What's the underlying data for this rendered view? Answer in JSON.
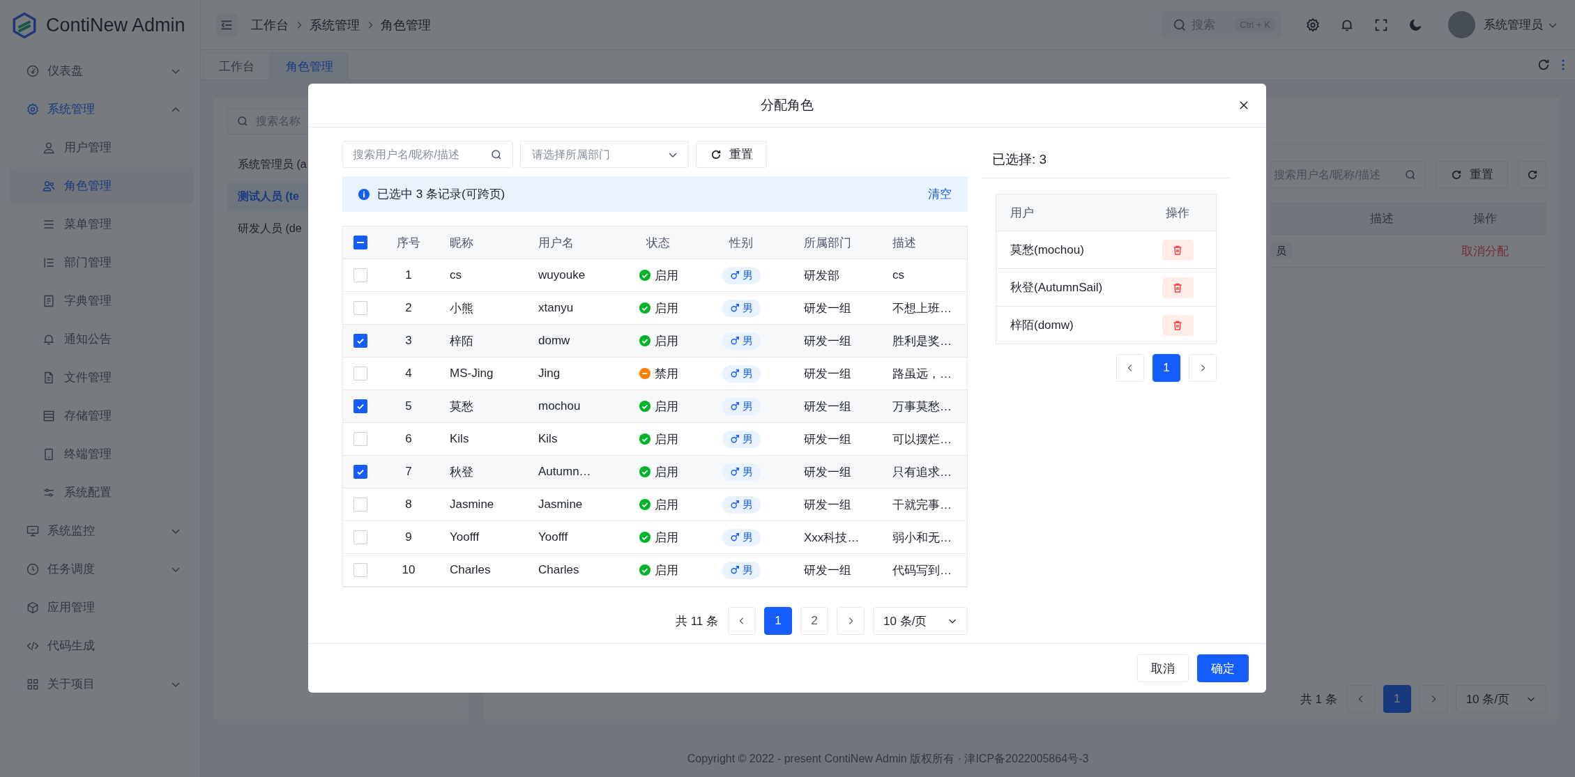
{
  "app": {
    "name": "ContiNew Admin"
  },
  "sidebar": {
    "items": [
      {
        "label": "仪表盘",
        "expanded": false,
        "selected": false
      },
      {
        "label": "系统管理",
        "expanded": true,
        "selected": true,
        "children": [
          {
            "label": "用户管理",
            "selected": false
          },
          {
            "label": "角色管理",
            "selected": true
          },
          {
            "label": "菜单管理",
            "selected": false
          },
          {
            "label": "部门管理",
            "selected": false
          },
          {
            "label": "字典管理",
            "selected": false
          },
          {
            "label": "通知公告",
            "selected": false
          },
          {
            "label": "文件管理",
            "selected": false
          },
          {
            "label": "存储管理",
            "selected": false
          },
          {
            "label": "终端管理",
            "selected": false
          },
          {
            "label": "系统配置",
            "selected": false
          }
        ]
      },
      {
        "label": "系统监控",
        "expanded": false,
        "selected": false
      },
      {
        "label": "任务调度",
        "expanded": false,
        "selected": false
      },
      {
        "label": "应用管理",
        "selected": false
      },
      {
        "label": "代码生成",
        "selected": false
      },
      {
        "label": "关于项目",
        "expanded": false,
        "selected": false
      }
    ]
  },
  "header": {
    "breadcrumb": [
      "工作台",
      "系统管理",
      "角色管理"
    ],
    "search": {
      "placeholder": "搜索",
      "shortcut": "Ctrl + K"
    },
    "user": "系统管理员"
  },
  "tabs": [
    {
      "label": "工作台",
      "selected": false
    },
    {
      "label": "角色管理",
      "selected": true
    }
  ],
  "role_panel": {
    "search": {
      "placeholder": "搜索名称"
    },
    "roles": [
      {
        "label": "系统管理员 (a",
        "selected": false
      },
      {
        "label": "测试人员 (te",
        "selected": true
      },
      {
        "label": "研发人员 (de",
        "selected": false
      }
    ]
  },
  "user_panel": {
    "search": {
      "placeholder": "搜索用户名/昵称/描述"
    },
    "reset": "重置",
    "columns": [
      "描述",
      "操作"
    ],
    "rows": [
      {
        "tag": "员",
        "action": "取消分配"
      }
    ],
    "pagination": {
      "total": "共 1 条",
      "pages": [
        {
          "label": "1",
          "selected": true
        }
      ],
      "page_size": "10 条/页"
    }
  },
  "modal": {
    "title": "分配角色",
    "search": {
      "placeholder": "搜索用户名/昵称/描述"
    },
    "dept_select": {
      "placeholder": "请选择所属部门"
    },
    "reset": "重置",
    "alert": {
      "text": "已选中 3 条记录(可跨页)",
      "action": "清空"
    },
    "table": {
      "select_all_indeterminate": true,
      "columns": [
        "序号",
        "昵称",
        "用户名",
        "状态",
        "性别",
        "所属部门",
        "描述"
      ],
      "rows": [
        {
          "checked": false,
          "index": "1",
          "nickname": "cs",
          "username": "wuyouke",
          "status": {
            "kind": "enabled",
            "label": "启用"
          },
          "gender": "男",
          "dept": "研发部",
          "description": "cs"
        },
        {
          "checked": false,
          "index": "2",
          "nickname": "小熊",
          "username": "xtanyu",
          "status": {
            "kind": "enabled",
            "label": "启用"
          },
          "gender": "男",
          "dept": "研发一组",
          "description": "不想上班…"
        },
        {
          "checked": true,
          "index": "3",
          "nickname": "梓陌",
          "username": "domw",
          "status": {
            "kind": "enabled",
            "label": "启用"
          },
          "gender": "男",
          "dept": "研发一组",
          "description": "胜利是奖…"
        },
        {
          "checked": false,
          "index": "4",
          "nickname": "MS-Jing",
          "username": "Jing",
          "status": {
            "kind": "disabled",
            "label": "禁用"
          },
          "gender": "男",
          "dept": "研发一组",
          "description": "路虽远，…"
        },
        {
          "checked": true,
          "index": "5",
          "nickname": "莫愁",
          "username": "mochou",
          "status": {
            "kind": "enabled",
            "label": "启用"
          },
          "gender": "男",
          "dept": "研发一组",
          "description": "万事莫愁…"
        },
        {
          "checked": false,
          "index": "6",
          "nickname": "Kils",
          "username": "Kils",
          "status": {
            "kind": "enabled",
            "label": "启用"
          },
          "gender": "男",
          "dept": "研发一组",
          "description": "可以摆烂…"
        },
        {
          "checked": true,
          "index": "7",
          "nickname": "秋登",
          "username": "Autumn…",
          "status": {
            "kind": "enabled",
            "label": "启用"
          },
          "gender": "男",
          "dept": "研发一组",
          "description": "只有追求…"
        },
        {
          "checked": false,
          "index": "8",
          "nickname": "Jasmine",
          "username": "Jasmine",
          "status": {
            "kind": "enabled",
            "label": "启用"
          },
          "gender": "男",
          "dept": "研发一组",
          "description": "干就完事…"
        },
        {
          "checked": false,
          "index": "9",
          "nickname": "Yoofff",
          "username": "Yoofff",
          "status": {
            "kind": "enabled",
            "label": "启用"
          },
          "gender": "男",
          "dept": "Xxx科技…",
          "description": "弱小和无…"
        },
        {
          "checked": false,
          "index": "10",
          "nickname": "Charles",
          "username": "Charles",
          "status": {
            "kind": "enabled",
            "label": "启用"
          },
          "gender": "男",
          "dept": "研发一组",
          "description": "代码写到…"
        }
      ]
    },
    "pagination": {
      "total": "共 11 条",
      "pages": [
        {
          "label": "1",
          "selected": true
        },
        {
          "label": "2",
          "selected": false
        }
      ],
      "page_size": "10 条/页"
    },
    "selected": {
      "title": "已选择: 3",
      "columns": [
        "用户",
        "操作"
      ],
      "rows": [
        "莫愁(mochou)",
        "秋登(AutumnSail)",
        "梓陌(domw)"
      ],
      "pagination": {
        "pages": [
          {
            "label": "1",
            "selected": true
          }
        ]
      }
    },
    "buttons": [
      {
        "label": "取消",
        "kind": "secondary"
      },
      {
        "label": "确定",
        "kind": "primary"
      }
    ]
  },
  "footer": "Copyright © 2022 - present ContiNew Admin 版权所有 · 津ICP备2022005864号-3"
}
